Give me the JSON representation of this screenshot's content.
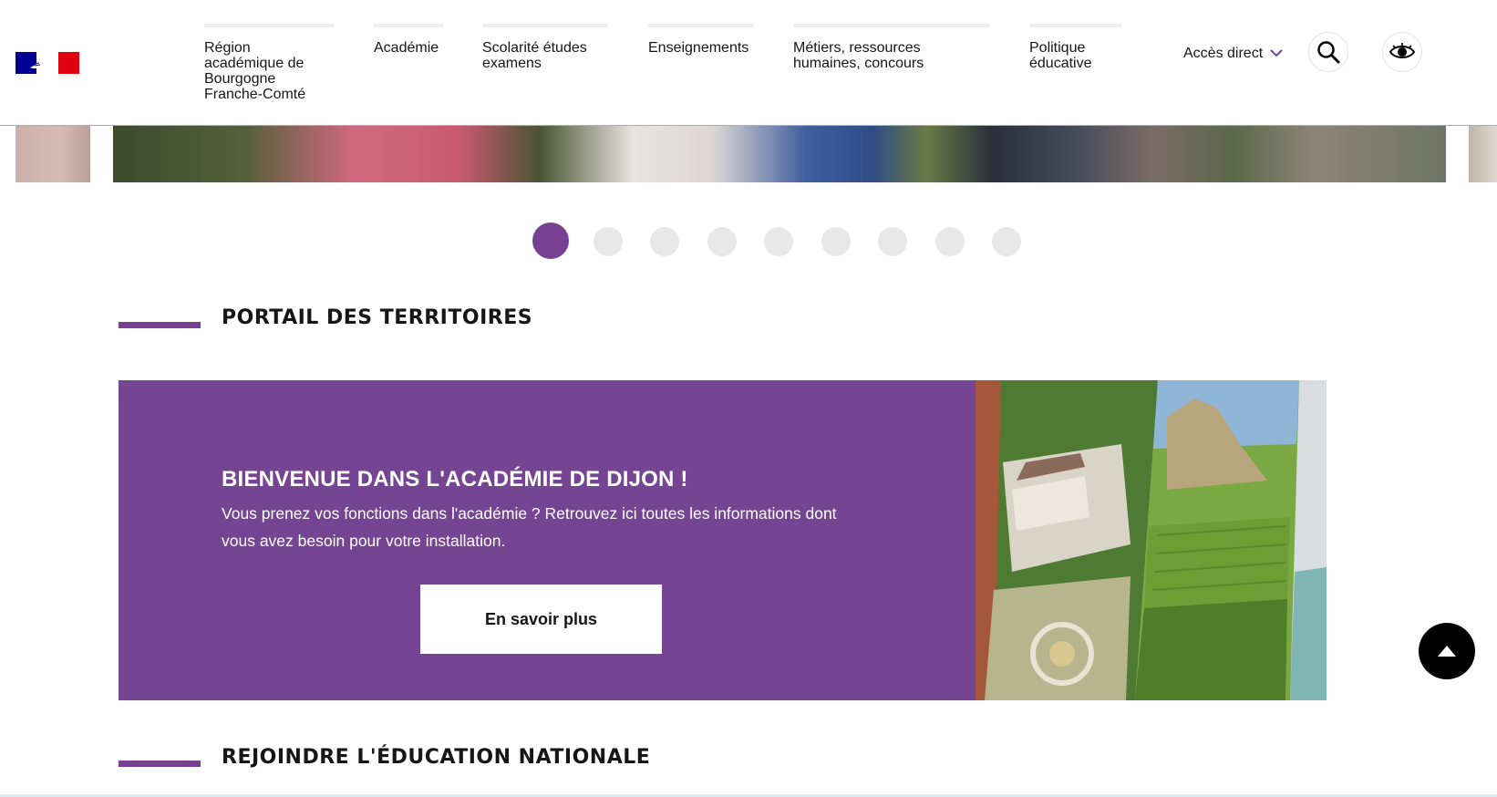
{
  "header": {
    "nav": [
      {
        "label": "Région\nacadémique de\nBourgogne\nFranche-Comté"
      },
      {
        "label": "Académie"
      },
      {
        "label": "Scolarité études\nexamens"
      },
      {
        "label": "Enseignements"
      },
      {
        "label": "Métiers, ressources\nhumaines, concours"
      },
      {
        "label": "Politique\néducative"
      }
    ],
    "acces_direct": "Accès direct",
    "search_icon": "search-icon",
    "accessibility_icon": "eye-icon"
  },
  "carousel": {
    "slide_count": 9,
    "active_index": 0
  },
  "sections": {
    "portail": "PORTAIL DES TERRITOIRES",
    "rejoindre": "REJOINDRE L'ÉDUCATION NATIONALE"
  },
  "banner": {
    "title": "BIENVENUE DANS L'ACADÉMIE DE DIJON !",
    "text": "Vous prenez vos fonctions dans l'académie ? Retrouvez ici toutes les informations dont vous avez besoin pour votre installation.",
    "button": "En savoir plus"
  },
  "colors": {
    "accent": "#774193",
    "banner_bg": "#754594"
  },
  "back_to_top_icon": "arrow-up-icon"
}
